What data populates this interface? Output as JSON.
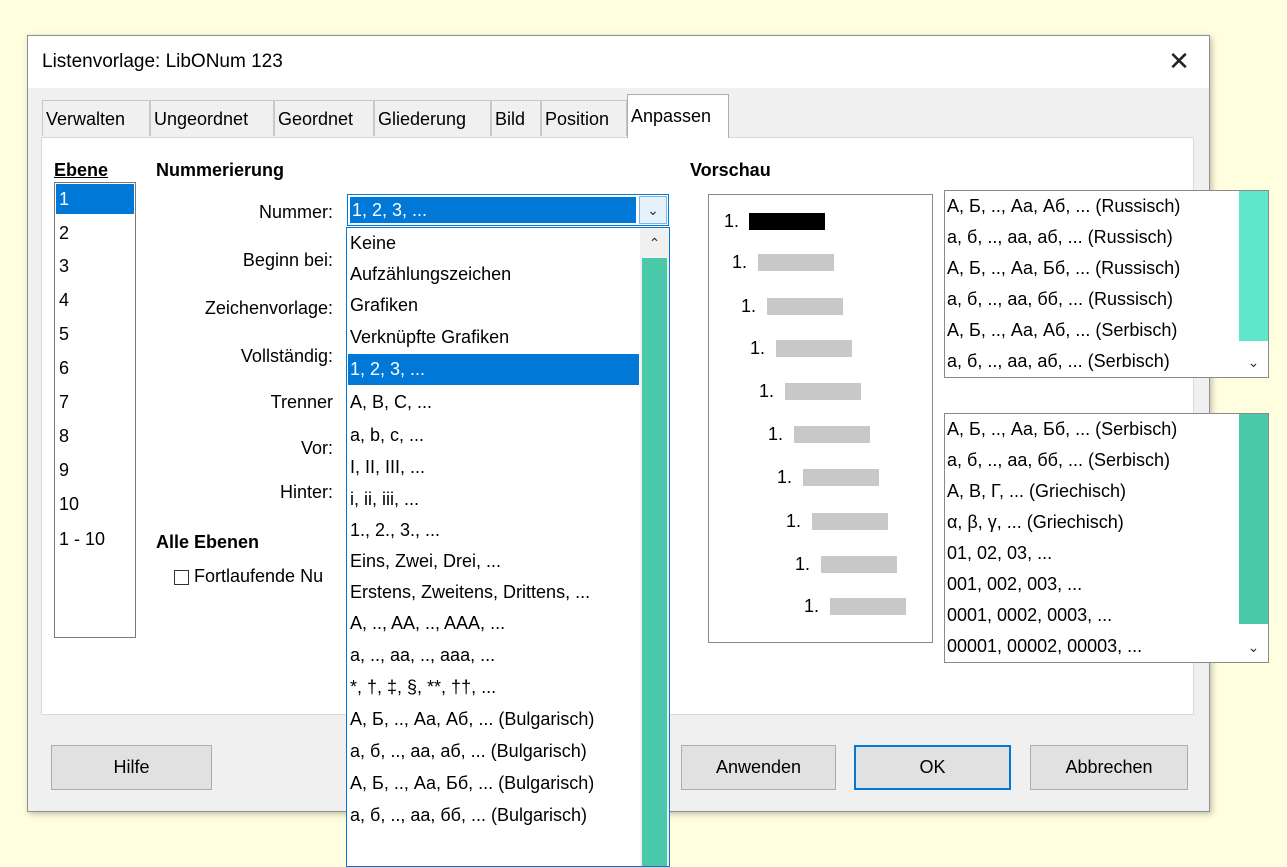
{
  "dialog": {
    "title": "Listenvorlage: LibONum 123",
    "close_icon": "close-icon"
  },
  "tabs": [
    {
      "label": "Verwalten"
    },
    {
      "label": "Ungeordnet"
    },
    {
      "label": "Geordnet"
    },
    {
      "label": "Gliederung"
    },
    {
      "label": "Bild"
    },
    {
      "label": "Position"
    },
    {
      "label": "Anpassen",
      "active": true
    }
  ],
  "ebene": {
    "header": "Ebene",
    "levels": [
      "1",
      "2",
      "3",
      "4",
      "5",
      "6",
      "7",
      "8",
      "9",
      "10",
      "1 - 10"
    ],
    "selected": "1"
  },
  "numbering": {
    "header": "Nummerierung",
    "labels": {
      "nummer": "Nummer:",
      "beginn": "Beginn bei:",
      "zeichenvorlage": "Zeichenvorlage:",
      "vollstaendig": "Vollständig:",
      "trenner": "Trenner",
      "vor": "Vor:",
      "hinter": "Hinter:"
    },
    "combo_value": "1, 2, 3, ...",
    "alle_ebenen": "Alle Ebenen",
    "fortlaufend": "Fortlaufende Nu"
  },
  "dropdown": {
    "options": [
      "Keine",
      "Aufzählungszeichen",
      "Grafiken",
      "Verknüpfte Grafiken",
      "1, 2, 3, ...",
      "A, B, C, ...",
      "a, b, c, ...",
      "I, II, III, ...",
      "i, ii, iii, ...",
      "1., 2., 3., ...",
      "Eins, Zwei, Drei, ...",
      "Erstens, Zweitens, Drittens, ...",
      "A, .., AA, .., AAA, ...",
      "a, .., aa, .., aaa, ...",
      "*, †, ‡, §, **, ††, ...",
      "А, Б, .., Аа, Аб, ... (Bulgarisch)",
      "а, б, .., аа, аб, ... (Bulgarisch)",
      "А, Б, .., Аа, Бб, ... (Bulgarisch)",
      "а, б, .., аа, бб, ... (Bulgarisch)"
    ],
    "selected": "1, 2, 3, ..."
  },
  "preview": {
    "header": "Vorschau",
    "number_label": "1."
  },
  "extra_list_top": [
    "А, Б, .., Аа, Аб, ... (Russisch)",
    "а, б, .., аа, аб, ... (Russisch)",
    "А, Б, .., Аа, Бб, ... (Russisch)",
    "а, б, .., аа, бб, ... (Russisch)",
    "А, Б, .., Аа, Аб, ... (Serbisch)",
    "а, б, .., аа, аб, ... (Serbisch)"
  ],
  "extra_list_bottom": [
    "А, Б, .., Аа, Бб, ... (Serbisch)",
    "а, б, .., аа, бб, ... (Serbisch)",
    "Α, Β, Γ, ... (Griechisch)",
    "α, β, γ, ... (Griechisch)",
    "01, 02, 03, ...",
    "001, 002, 003, ...",
    "0001, 0002, 0003, ...",
    "00001, 00002, 00003, ..."
  ],
  "buttons": {
    "hilfe": "Hilfe",
    "anwenden": "Anwenden",
    "ok": "OK",
    "abbrechen": "Abbrechen"
  },
  "colors": {
    "selection": "#0078d7",
    "scroll_thumb": "#49c9a9",
    "background": "#fffedf"
  }
}
